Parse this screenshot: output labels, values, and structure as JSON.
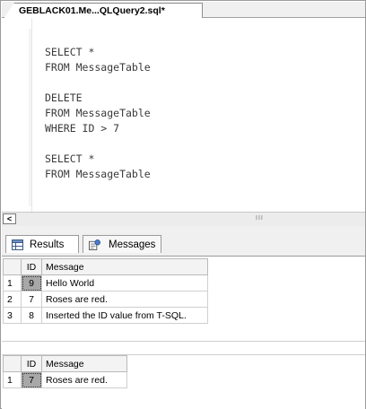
{
  "tab": {
    "title": "GEBLACK01.Me...QLQuery2.sql*"
  },
  "editor": {
    "lines": [
      "SELECT *",
      "FROM MessageTable",
      "",
      "DELETE",
      "FROM MessageTable",
      "WHERE ID > 7",
      "",
      "SELECT *",
      "FROM MessageTable"
    ]
  },
  "scrollbar": {
    "left_arrow": "<",
    "grip": "III"
  },
  "results_tabs": {
    "results_label": "Results",
    "messages_label": "Messages"
  },
  "grid1": {
    "headers": [
      "ID",
      "Message"
    ],
    "rows": [
      {
        "num": "1",
        "id": "9",
        "message": "Hello World"
      },
      {
        "num": "2",
        "id": "7",
        "message": "Roses are red."
      },
      {
        "num": "3",
        "id": "8",
        "message": "Inserted the ID value from T-SQL."
      }
    ]
  },
  "grid2": {
    "headers": [
      "ID",
      "Message"
    ],
    "rows": [
      {
        "num": "1",
        "id": "7",
        "message": "Roses are red."
      }
    ]
  },
  "colors": {
    "selected_cell": "#a8a8a8",
    "tab_bg": "#f0f0f0",
    "border": "#9b9b9b"
  },
  "icons": {
    "results_icon": "grid-icon",
    "messages_icon": "messages-icon"
  }
}
